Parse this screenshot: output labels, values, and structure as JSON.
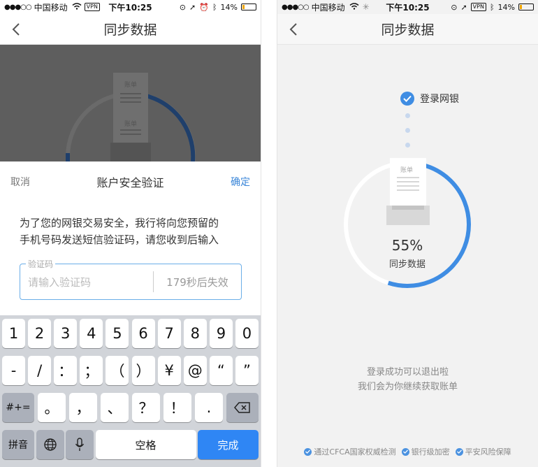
{
  "status_left": {
    "dots": "●●●○○",
    "carrier": "中国移动",
    "vpn": "VPN",
    "time": "下午10:25",
    "battery": "14%"
  },
  "status_right": {
    "dots": "●●●○○",
    "carrier": "中国移动",
    "vpn": "VPN",
    "time": "下午10:25",
    "battery": "14%"
  },
  "left": {
    "nav_title": "同步数据",
    "dim_labels": [
      "账单",
      "账单"
    ],
    "sheet": {
      "cancel": "取消",
      "title": "账户安全验证",
      "confirm": "确定",
      "message_line1": "为了您的网银交易安全，我行将向您预留的",
      "message_line2": "手机号码发送短信验证码，请您收到后输入",
      "code_legend": "验证码",
      "code_placeholder": "请输入验证码",
      "countdown": "179秒后失效"
    },
    "keyboard": {
      "row1": [
        "1",
        "2",
        "3",
        "4",
        "5",
        "6",
        "7",
        "8",
        "9",
        "0"
      ],
      "row2": [
        "-",
        "/",
        "：",
        "；",
        "（",
        "）",
        "¥",
        "@",
        "“",
        "”"
      ],
      "row3_switch": "#+=",
      "row3": [
        "。",
        "，",
        "、",
        "？",
        "！",
        "."
      ],
      "lang": "拼音",
      "space": "空格",
      "done": "完成"
    }
  },
  "right": {
    "nav_title": "同步数据",
    "step_label": "登录网银",
    "bill_label": "账单",
    "progress_percent": 55,
    "progress_text": "55%",
    "progress_label": "同步数据",
    "hint_line1": "登录成功可以退出啦",
    "hint_line2": "我们会为你继续获取账单",
    "footer": [
      "通过CFCA国家权威检测",
      "银行级加密",
      "平安风险保障"
    ]
  },
  "colors": {
    "accent": "#3f8de3",
    "done_key": "#2f86f4",
    "dim": "#5e5e5e"
  }
}
